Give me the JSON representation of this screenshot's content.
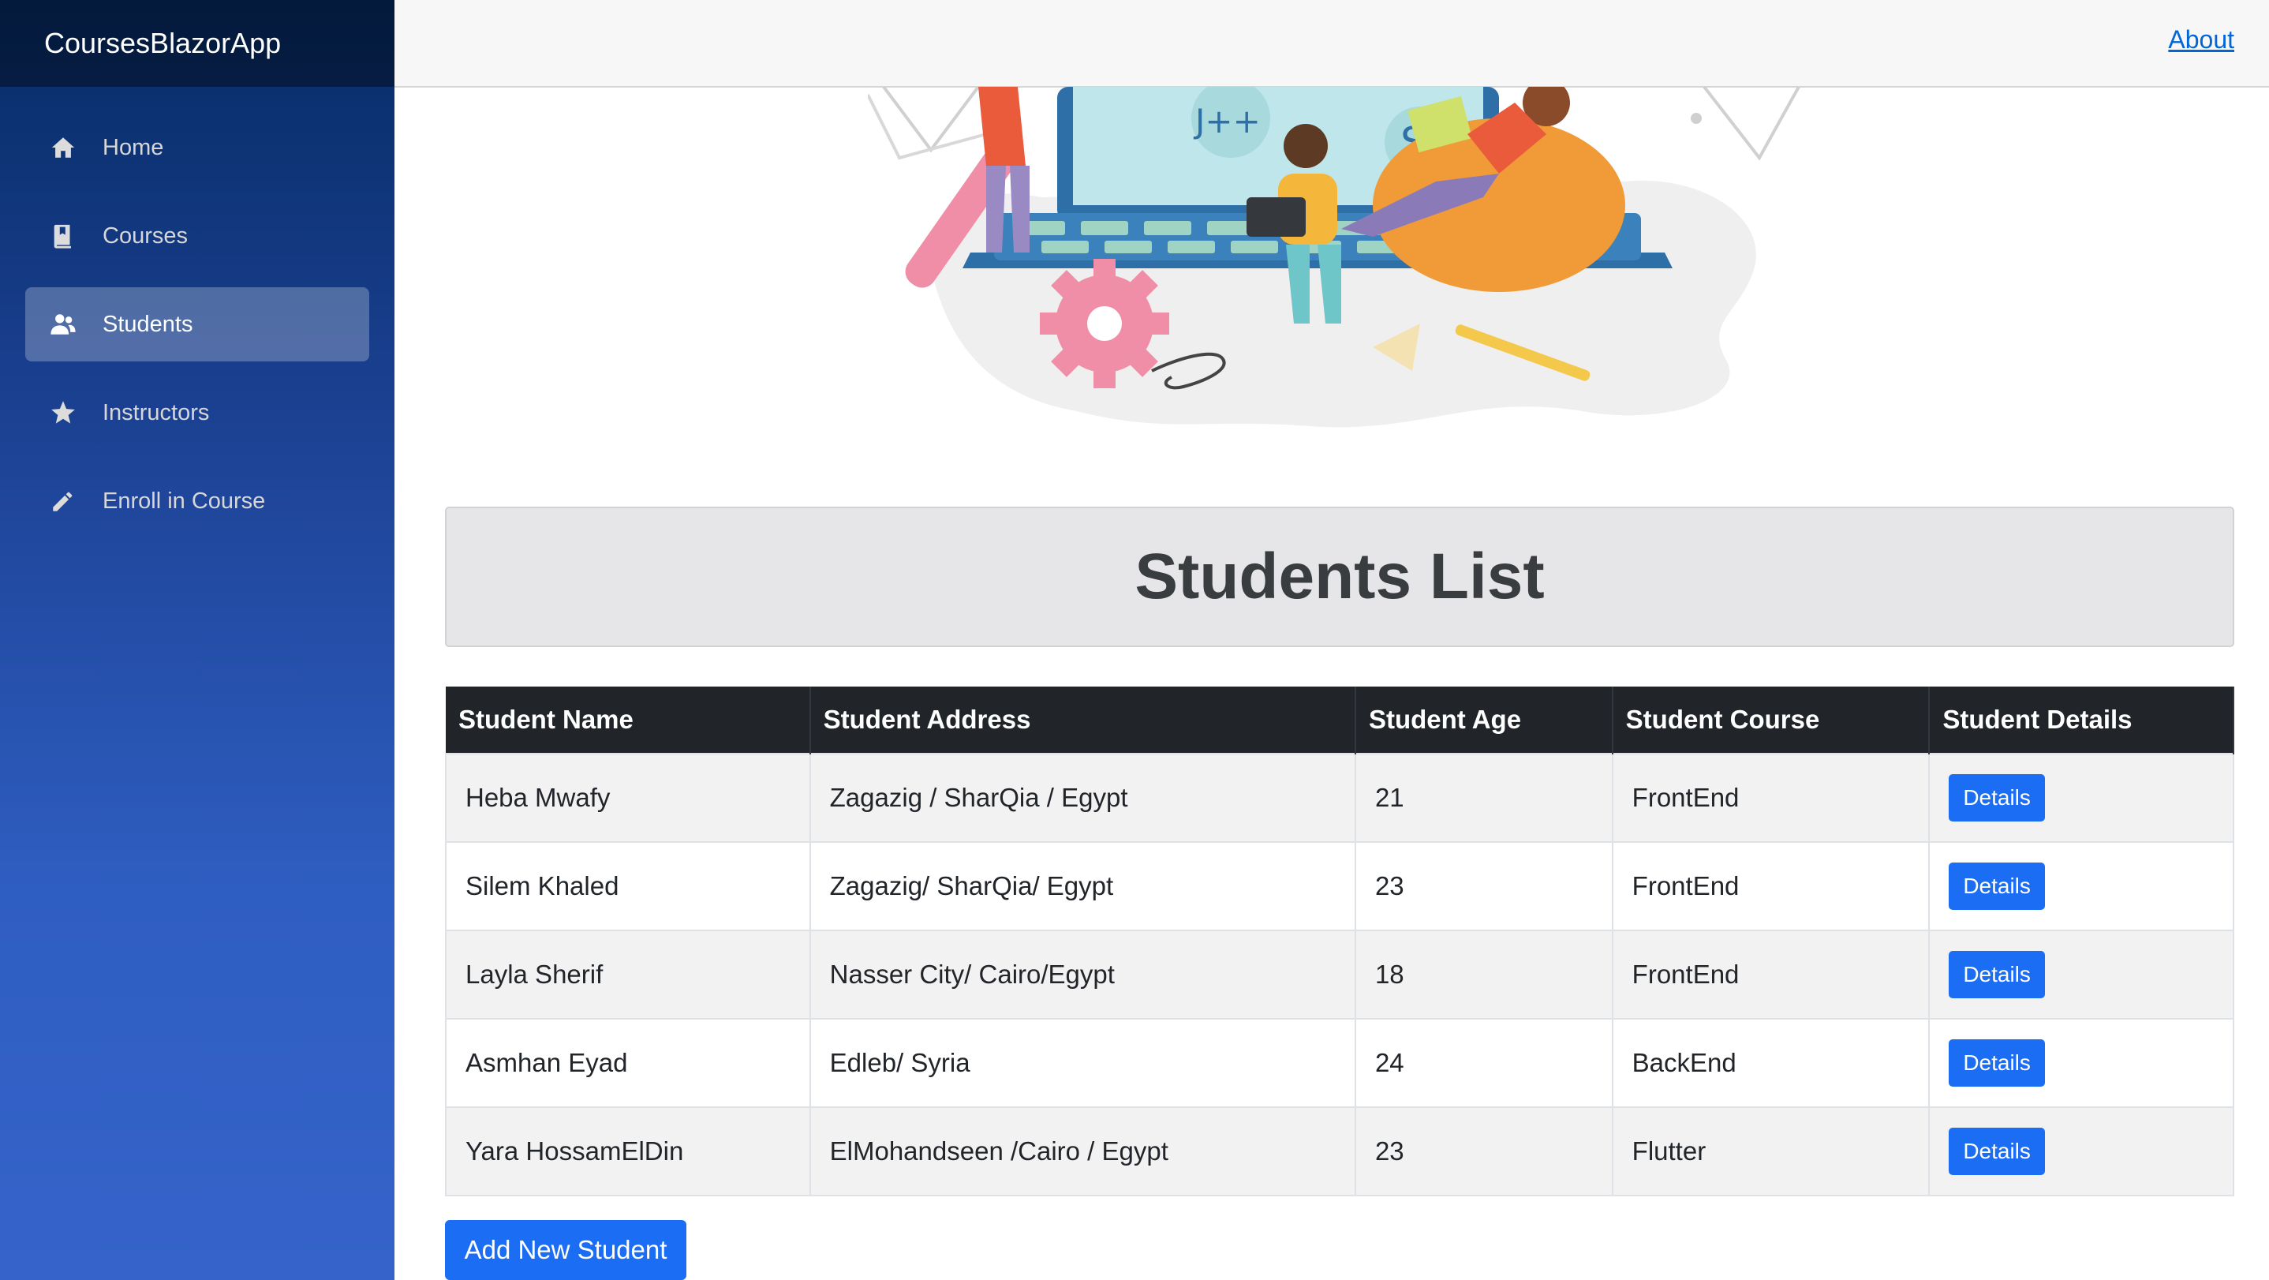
{
  "app": {
    "brand": "CoursesBlazorApp"
  },
  "sidebar": {
    "items": [
      {
        "label": "Home",
        "icon": "home-icon",
        "active": false
      },
      {
        "label": "Courses",
        "icon": "book-icon",
        "active": false
      },
      {
        "label": "Students",
        "icon": "people-icon",
        "active": true
      },
      {
        "label": "Instructors",
        "icon": "star-icon",
        "active": false
      },
      {
        "label": "Enroll in Course",
        "icon": "pencil-icon",
        "active": false
      }
    ]
  },
  "topbar": {
    "about_label": "About"
  },
  "hero": {
    "badge_j": "J++",
    "badge_s": "S"
  },
  "page": {
    "title": "Students List"
  },
  "table": {
    "headers": [
      "Student Name",
      "Student Address",
      "Student Age",
      "Student Course",
      "Student Details"
    ],
    "rows": [
      {
        "name": "Heba Mwafy",
        "address": "Zagazig / SharQia / Egypt",
        "age": "21",
        "course": "FrontEnd",
        "details_label": "Details"
      },
      {
        "name": "Silem Khaled",
        "address": "Zagazig/ SharQia/ Egypt",
        "age": "23",
        "course": "FrontEnd",
        "details_label": "Details"
      },
      {
        "name": "Layla Sherif",
        "address": "Nasser City/ Cairo/Egypt",
        "age": "18",
        "course": "FrontEnd",
        "details_label": "Details"
      },
      {
        "name": "Asmhan Eyad",
        "address": "Edleb/ Syria",
        "age": "24",
        "course": "BackEnd",
        "details_label": "Details"
      },
      {
        "name": "Yara HossamElDin",
        "address": "ElMohandseen /Cairo / Egypt",
        "age": "23",
        "course": "Flutter",
        "details_label": "Details"
      }
    ]
  },
  "actions": {
    "add_label": "Add New Student"
  },
  "colors": {
    "primary": "#1b6ef3",
    "header_dark": "#212529",
    "link": "#0366d6"
  }
}
